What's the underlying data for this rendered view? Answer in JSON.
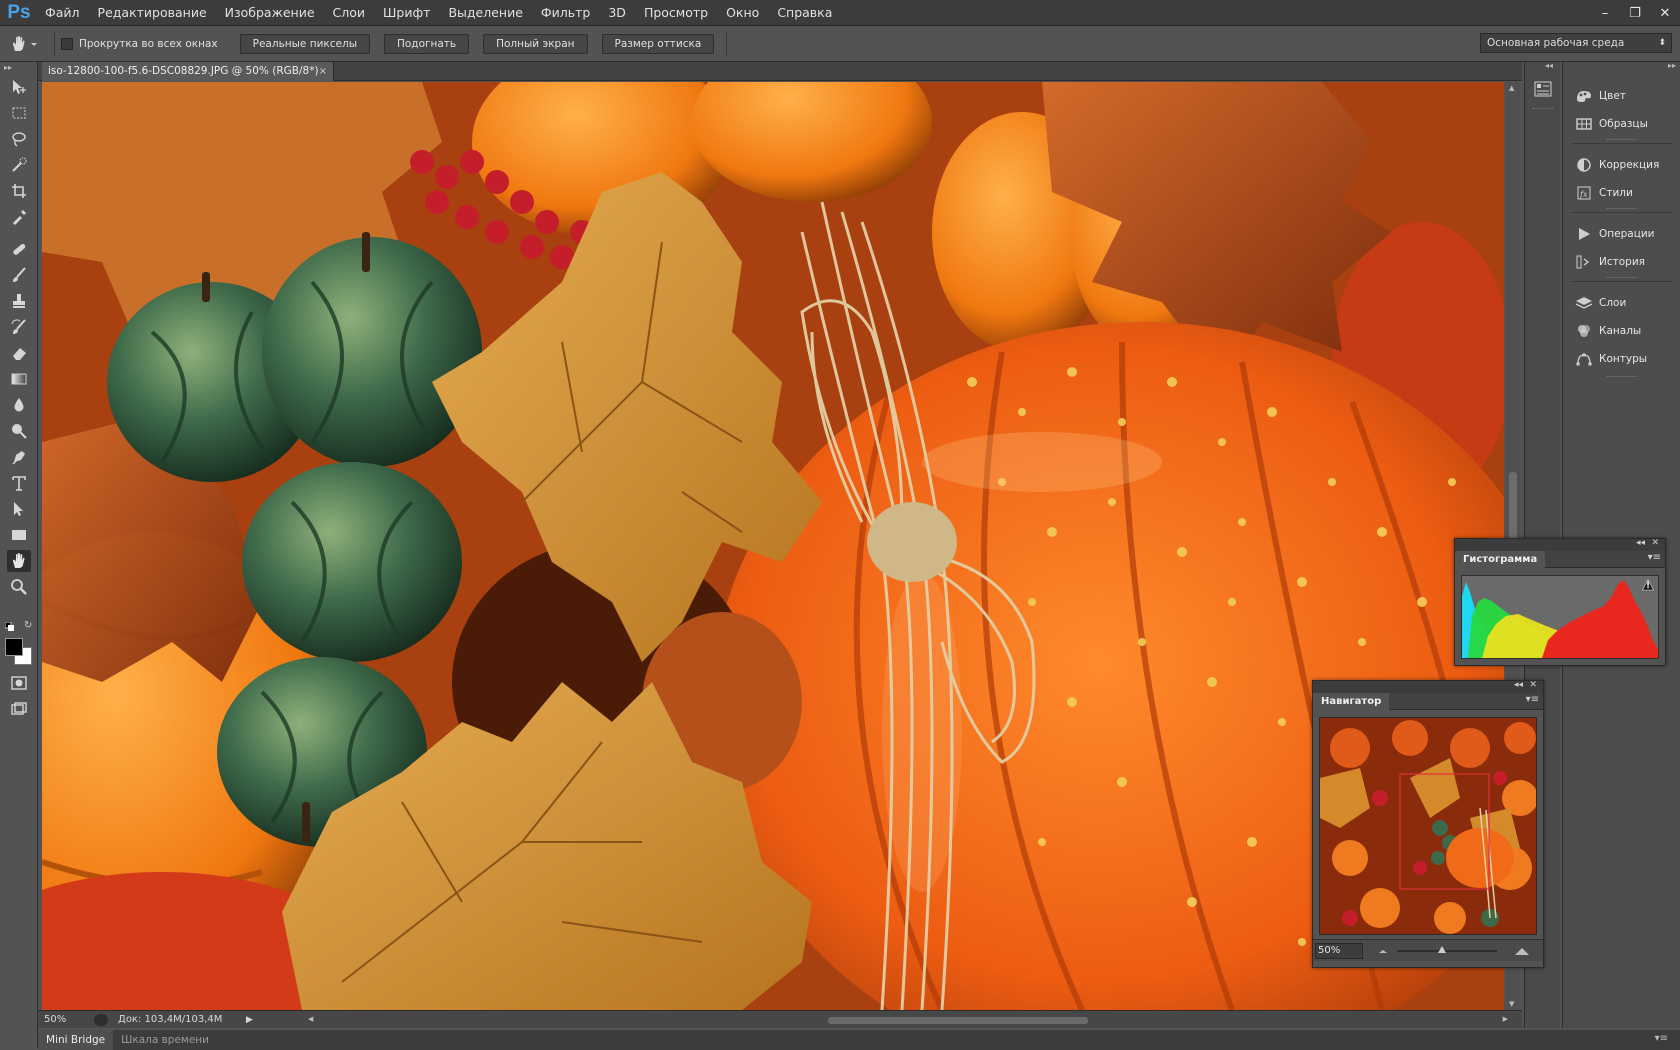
{
  "app": {
    "logo": "Ps",
    "menu": [
      "Файл",
      "Редактирование",
      "Изображение",
      "Слои",
      "Шрифт",
      "Выделение",
      "Фильтр",
      "3D",
      "Просмотр",
      "Окно",
      "Справка"
    ],
    "window_controls": [
      "–",
      "❐",
      "✕"
    ]
  },
  "options": {
    "scroll_all_label": "Прокрутка во всех окнах",
    "buttons": [
      "Реальные пикселы",
      "Подогнать",
      "Полный экран",
      "Размер оттиска"
    ],
    "workspace": "Основная рабочая среда"
  },
  "document": {
    "tab_title": "iso-12800-100-f5.6-DSC08829.JPG @ 50% (RGB/8*)",
    "close_glyph": "×"
  },
  "status": {
    "zoom": "50%",
    "doc_info": "Док: 103,4M/103,4M"
  },
  "bottom_tabs": [
    "Mini Bridge",
    "Шкала времени"
  ],
  "dock": {
    "items": [
      {
        "label": "Цвет",
        "icon": "color-icon"
      },
      {
        "label": "Образцы",
        "icon": "swatches-icon"
      },
      {
        "label": "Коррекция",
        "icon": "adjustments-icon"
      },
      {
        "label": "Стили",
        "icon": "styles-icon"
      },
      {
        "label": "Операции",
        "icon": "actions-icon"
      },
      {
        "label": "История",
        "icon": "history-icon"
      },
      {
        "label": "Слои",
        "icon": "layers-icon"
      },
      {
        "label": "Каналы",
        "icon": "channels-icon"
      },
      {
        "label": "Контуры",
        "icon": "paths-icon"
      }
    ]
  },
  "histogram": {
    "title": "Гистограмма",
    "warning": "!"
  },
  "navigator": {
    "title": "Навигатор",
    "zoom": "50%",
    "zoom_level": 0.45
  },
  "colors": {
    "accent": "#4aa3e8",
    "foreground": "#000000",
    "background": "#ffffff",
    "nav_box": "#e0303a"
  }
}
